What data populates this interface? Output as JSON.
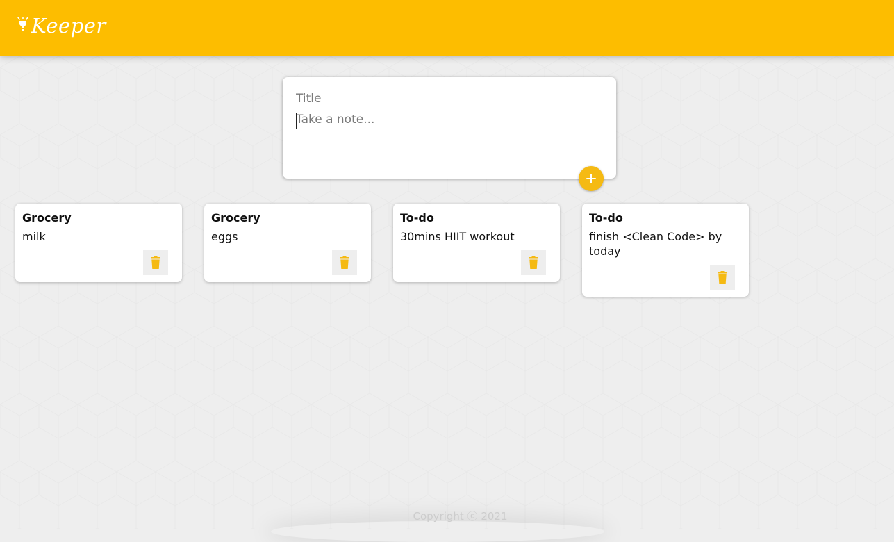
{
  "app": {
    "name": "Keeper",
    "brand_color": "#fdbd00",
    "accent_color": "#f5ba13"
  },
  "create_note": {
    "title_placeholder": "Title",
    "content_placeholder": "Take a note...",
    "title_value": "",
    "content_value": "",
    "add_icon": "plus-icon"
  },
  "notes": [
    {
      "title": "Grocery",
      "content": "milk",
      "delete_icon": "trash-icon"
    },
    {
      "title": "Grocery",
      "content": "eggs",
      "delete_icon": "trash-icon"
    },
    {
      "title": "To-do",
      "content": "30mins HIIT workout",
      "delete_icon": "trash-icon"
    },
    {
      "title": "To-do",
      "content": "finish <Clean Code> by today",
      "delete_icon": "trash-icon"
    }
  ],
  "footer": {
    "copyright": "Copyright ⓒ 2021"
  }
}
